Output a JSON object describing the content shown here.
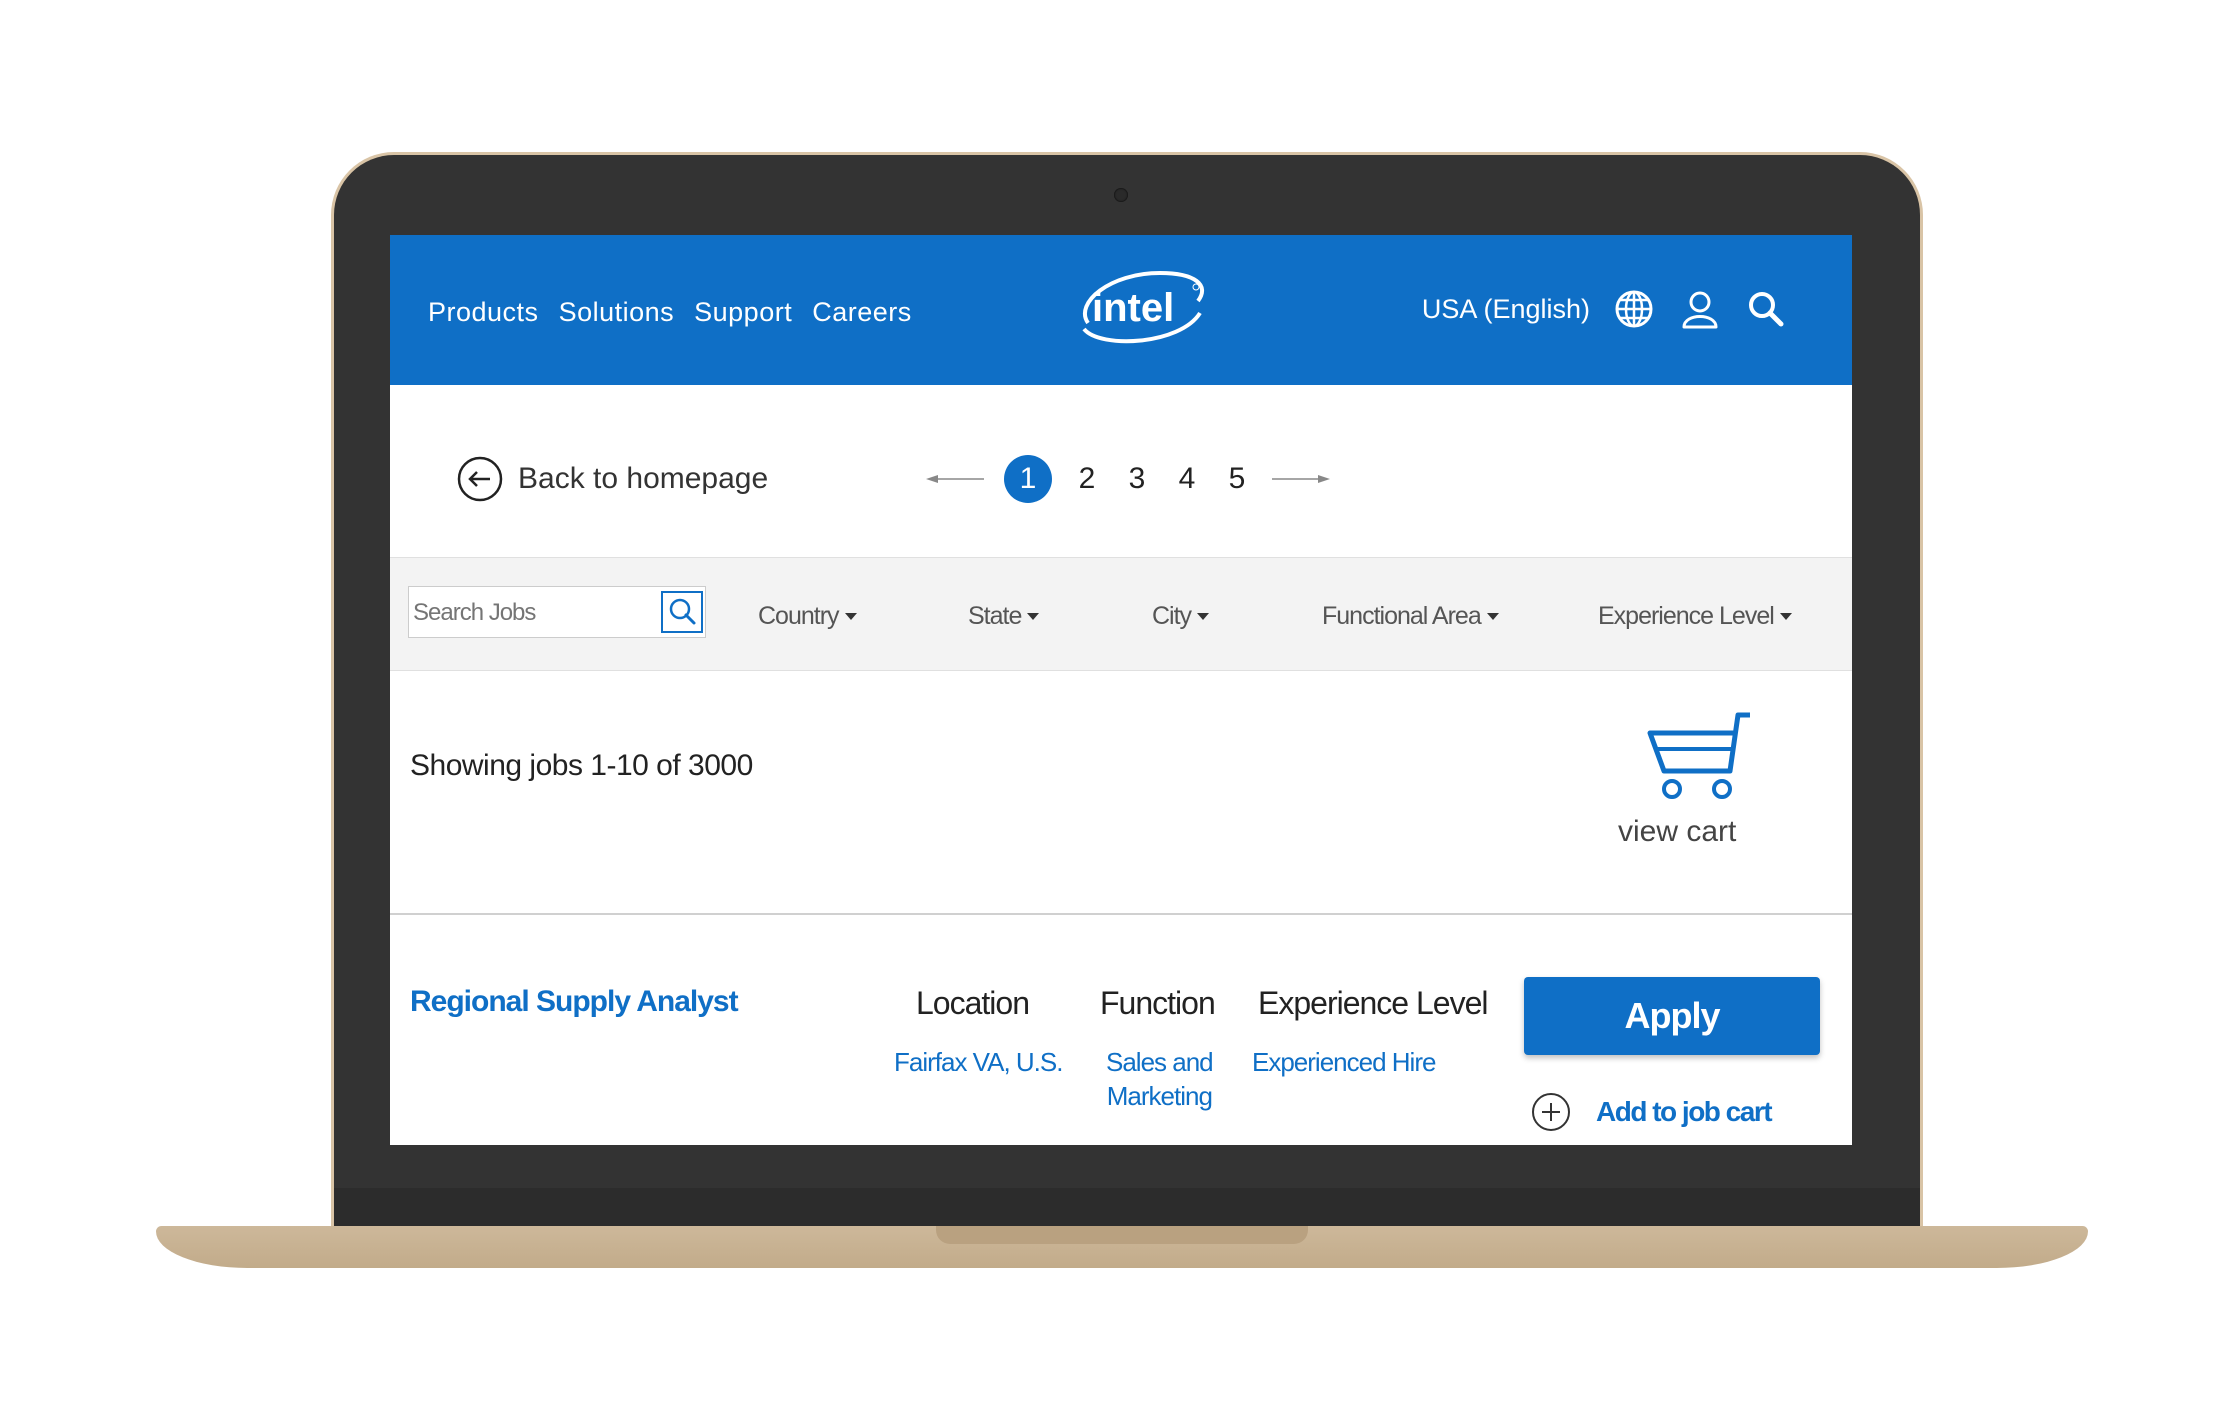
{
  "header": {
    "nav": [
      "Products",
      "Solutions",
      "Support",
      "Careers"
    ],
    "brand": "intel",
    "region": "USA (English)",
    "icons": [
      "globe-icon",
      "user-icon",
      "search-icon"
    ],
    "bg_color": "#0f6fc6"
  },
  "toolbar": {
    "back_label": "Back to homepage",
    "pages": [
      "1",
      "2",
      "3",
      "4",
      "5"
    ],
    "active_page": "1"
  },
  "filters": {
    "search_placeholder": "Search Jobs",
    "country": "Country",
    "state": "State",
    "city": "City",
    "functional_area": "Functional Area",
    "experience_level": "Experience Level"
  },
  "results": {
    "showing": "Showing  jobs 1-10  of  3000",
    "cart_label": "view cart"
  },
  "job": {
    "title": "Regional Supply Analyst",
    "location_head": "Location",
    "location": "Fairfax VA, U.S.",
    "function_head": "Function",
    "function_line1": "Sales and",
    "function_line2": "Marketing",
    "experience_head": "Experience Level",
    "experience": "Experienced  Hire",
    "apply_label": "Apply",
    "add_cart_label": "Add to job cart"
  },
  "accent_color": "#0f6fc6"
}
